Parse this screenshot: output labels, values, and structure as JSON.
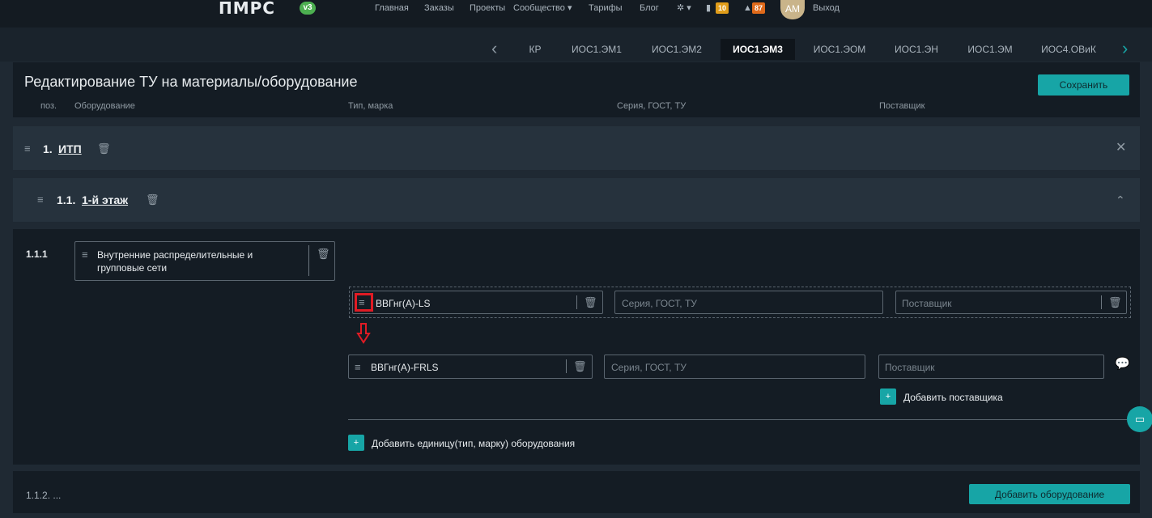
{
  "topnav": {
    "logo": "ПМРС",
    "logo_badge": "v3",
    "links": [
      "Главная",
      "Заказы",
      "Проекты",
      "Сообщество ▾",
      "Тарифы",
      "Блог"
    ],
    "messages_count": "10",
    "notifications_count": "87",
    "avatar_initials": "АМ",
    "logout": "Выход"
  },
  "tabs": [
    "КР",
    "ИОС1.ЭМ1",
    "ИОС1.ЭМ2",
    "ИОС1.ЭМ3",
    "ИОС1.ЭОМ",
    "ИОС1.ЭН",
    "ИОС1.ЭМ",
    "ИОС4.ОВиК"
  ],
  "active_tab": "ИОС1.ЭМ3",
  "header": {
    "title": "Редактирование ТУ на материалы/оборудование",
    "save_label": "Сохранить",
    "columns": [
      "поз.",
      "Оборудование",
      "Тип, марка",
      "Серия, ГОСТ, ТУ",
      "Поставщик"
    ]
  },
  "sections": {
    "s1_num": "1.",
    "s1_name": "ИТП",
    "s11_num": "1.1.",
    "s11_name": "1-й этаж"
  },
  "item": {
    "position": "1.1.1",
    "equipment": "Внутренние распределительные и групповые сети",
    "row1_type": "ВВГнг(А)-LS",
    "row1_series_ph": "Серия, ГОСТ, ТУ",
    "row1_supplier_ph": "Поставщик",
    "row2_type": "ВВГнг(А)-FRLS",
    "row2_series_ph": "Серия, ГОСТ, ТУ",
    "row2_supplier_ph": "Поставщик",
    "add_supplier": "Добавить поставщика",
    "add_unit": "Добавить единицу(тип, марку) оборудования"
  },
  "next_position": "1.1.2. ...",
  "add_equipment_label": "Добавить оборудование",
  "colors": {
    "accent": "#17a5a6",
    "highlight": "#e01b24"
  }
}
